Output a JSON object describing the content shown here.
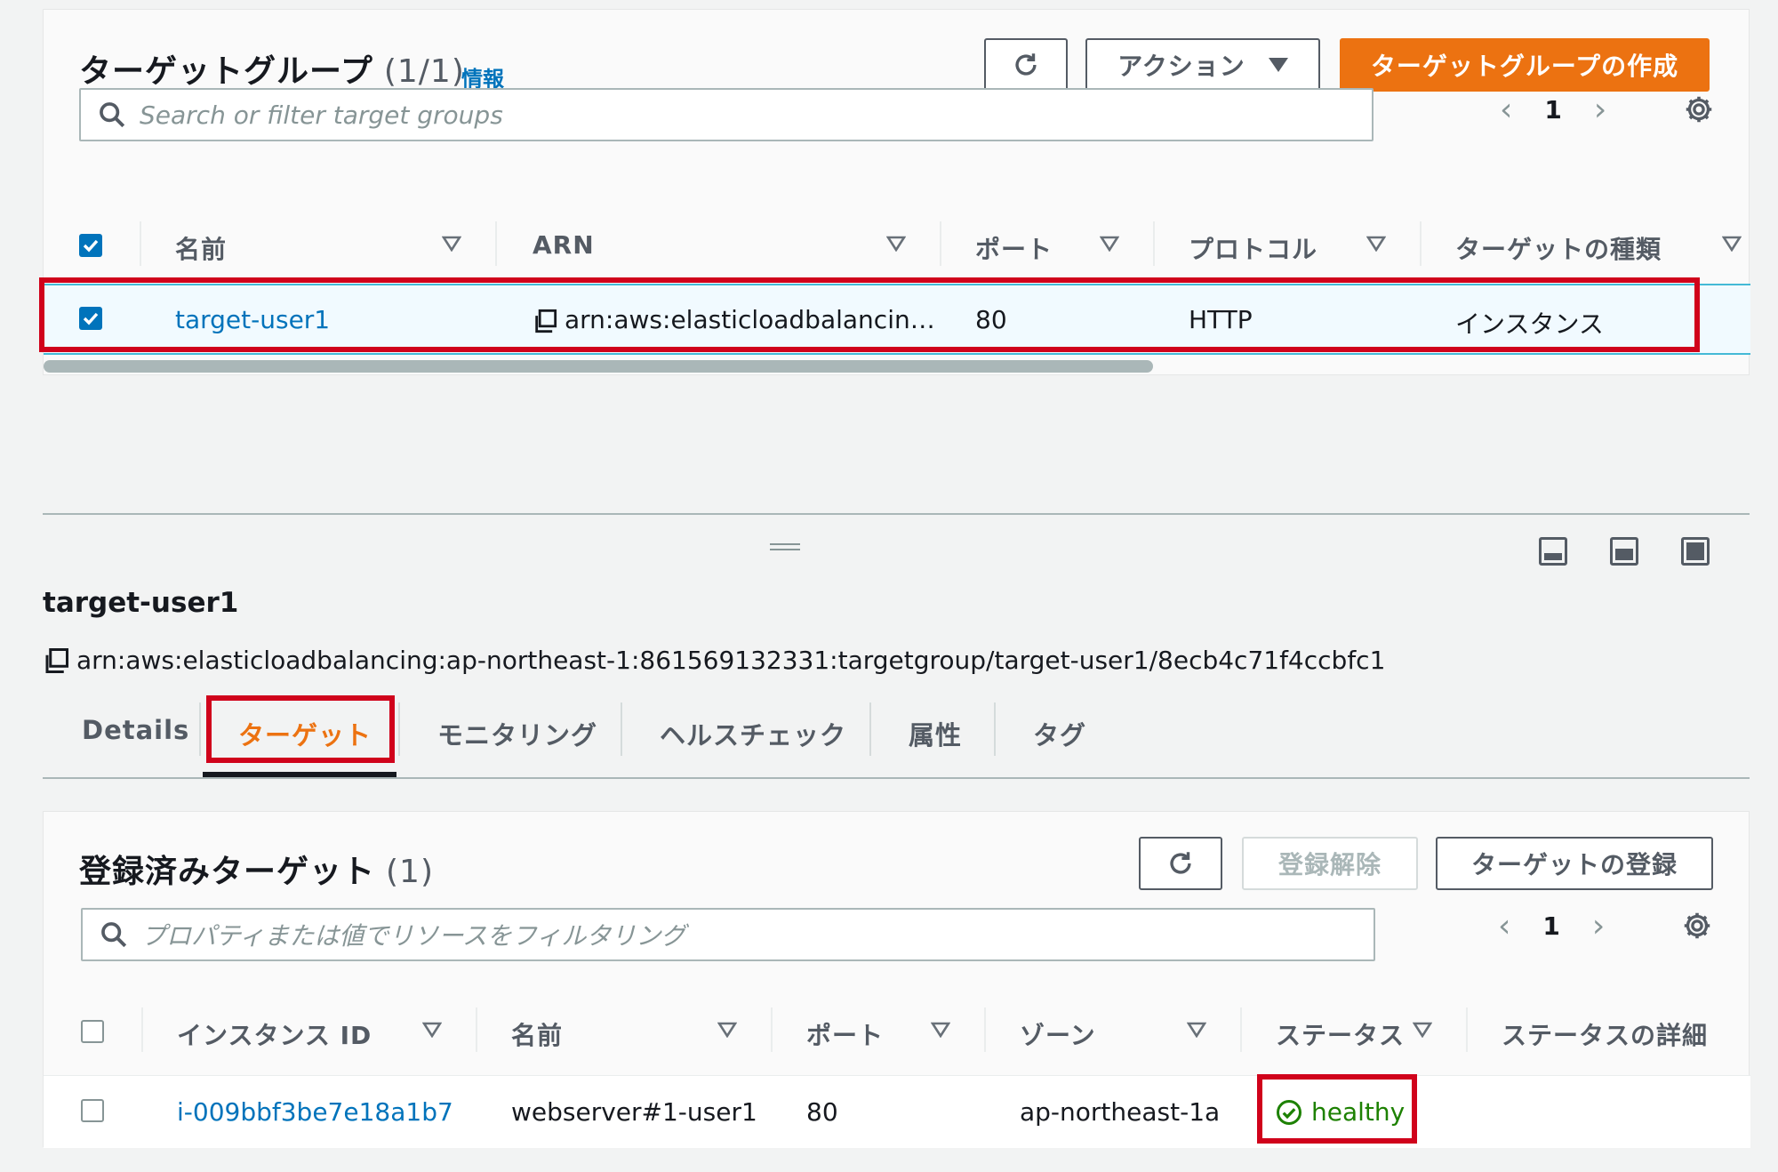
{
  "target_groups": {
    "title": "ターゲットグループ",
    "count": "(1/1)",
    "info_link": "情報",
    "actions_label": "アクション",
    "create_label": "ターゲットグループの作成",
    "search_placeholder": "Search or filter target groups",
    "page": "1",
    "columns": [
      "名前",
      "ARN",
      "ポート",
      "プロトコル",
      "ターゲットの種類"
    ],
    "row": {
      "name": "target-user1",
      "arn": "arn:aws:elasticloadbalancin…",
      "port": "80",
      "protocol": "HTTP",
      "target_type": "インスタンス"
    }
  },
  "detail": {
    "title": "target-user1",
    "arn": "arn:aws:elasticloadbalancing:ap-northeast-1:861569132331:targetgroup/target-user1/8ecb4c71f4ccbfc1",
    "tabs": [
      "Details",
      "ターゲット",
      "モニタリング",
      "ヘルスチェック",
      "属性",
      "タグ"
    ]
  },
  "registered_targets": {
    "title": "登録済みターゲット",
    "count": "(1)",
    "deregister_label": "登録解除",
    "register_label": "ターゲットの登録",
    "search_placeholder": "プロパティまたは値でリソースをフィルタリング",
    "page": "1",
    "columns": [
      "インスタンス ID",
      "名前",
      "ポート",
      "ゾーン",
      "ステータス",
      "ステータスの詳細"
    ],
    "row": {
      "instance_id": "i-009bbf3be7e18a1b7",
      "name": "webserver#1-user1",
      "port": "80",
      "zone": "ap-northeast-1a",
      "status": "healthy"
    }
  },
  "colors": {
    "accent_orange": "#ec7211",
    "link_blue": "#0073bb",
    "healthy_green": "#1d8102",
    "highlight_red": "#d0021b"
  }
}
